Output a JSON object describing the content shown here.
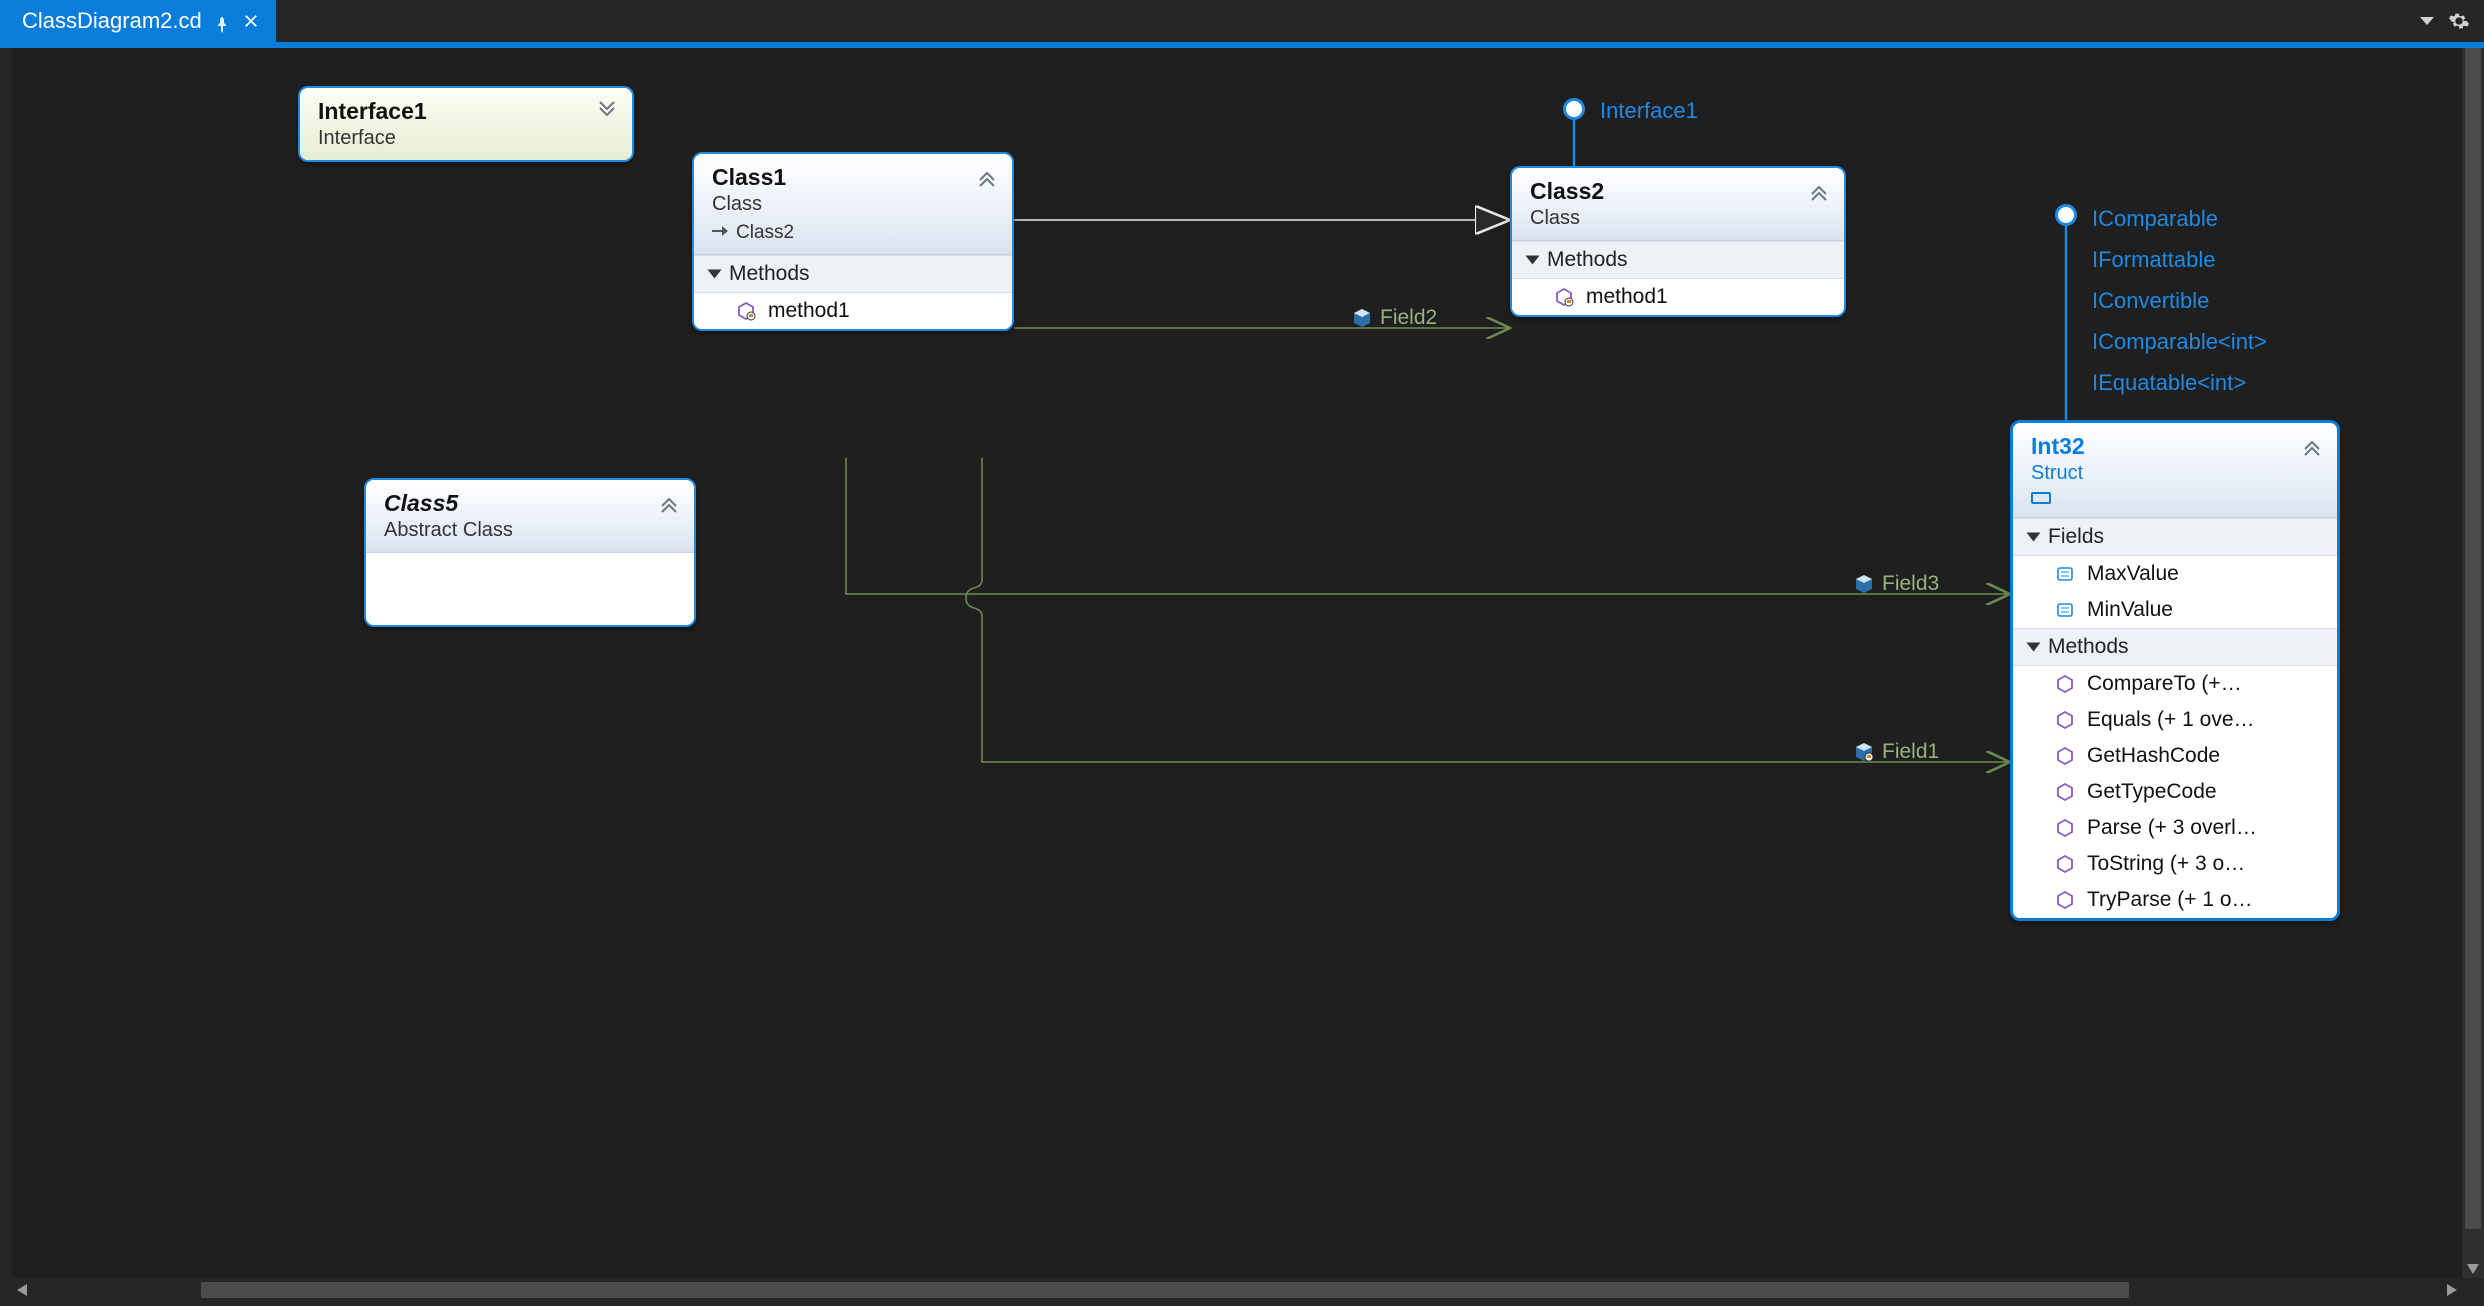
{
  "tab": {
    "title": "ClassDiagram2.cd"
  },
  "nodes": {
    "interface1": {
      "name": "Interface1",
      "sub": "Interface"
    },
    "class1": {
      "name": "Class1",
      "sub": "Class",
      "derived": "Class2",
      "section": "Methods",
      "m1": "method1"
    },
    "class2": {
      "name": "Class2",
      "sub": "Class",
      "section": "Methods",
      "m1": "method1"
    },
    "class5": {
      "name": "Class5",
      "sub": "Abstract Class"
    },
    "int32": {
      "name": "Int32",
      "sub": "Struct",
      "sectionFields": "Fields",
      "f1": "MaxValue",
      "f2": "MinValue",
      "sectionMethods": "Methods",
      "mm1": "CompareTo  (+…",
      "mm2": "Equals (+ 1 ove…",
      "mm3": "GetHashCode",
      "mm4": "GetTypeCode",
      "mm5": "Parse (+ 3 overl…",
      "mm6": "ToString (+ 3 o…",
      "mm7": "TryParse (+ 1 o…"
    }
  },
  "lollipops": {
    "class2": "Interface1",
    "int32": {
      "a": "IComparable",
      "b": "IFormattable",
      "c": "IConvertible",
      "d": "IComparable<int>",
      "e": "IEquatable<int>"
    }
  },
  "edges": {
    "field2": "Field2",
    "field3": "Field3",
    "field1": "Field1"
  }
}
